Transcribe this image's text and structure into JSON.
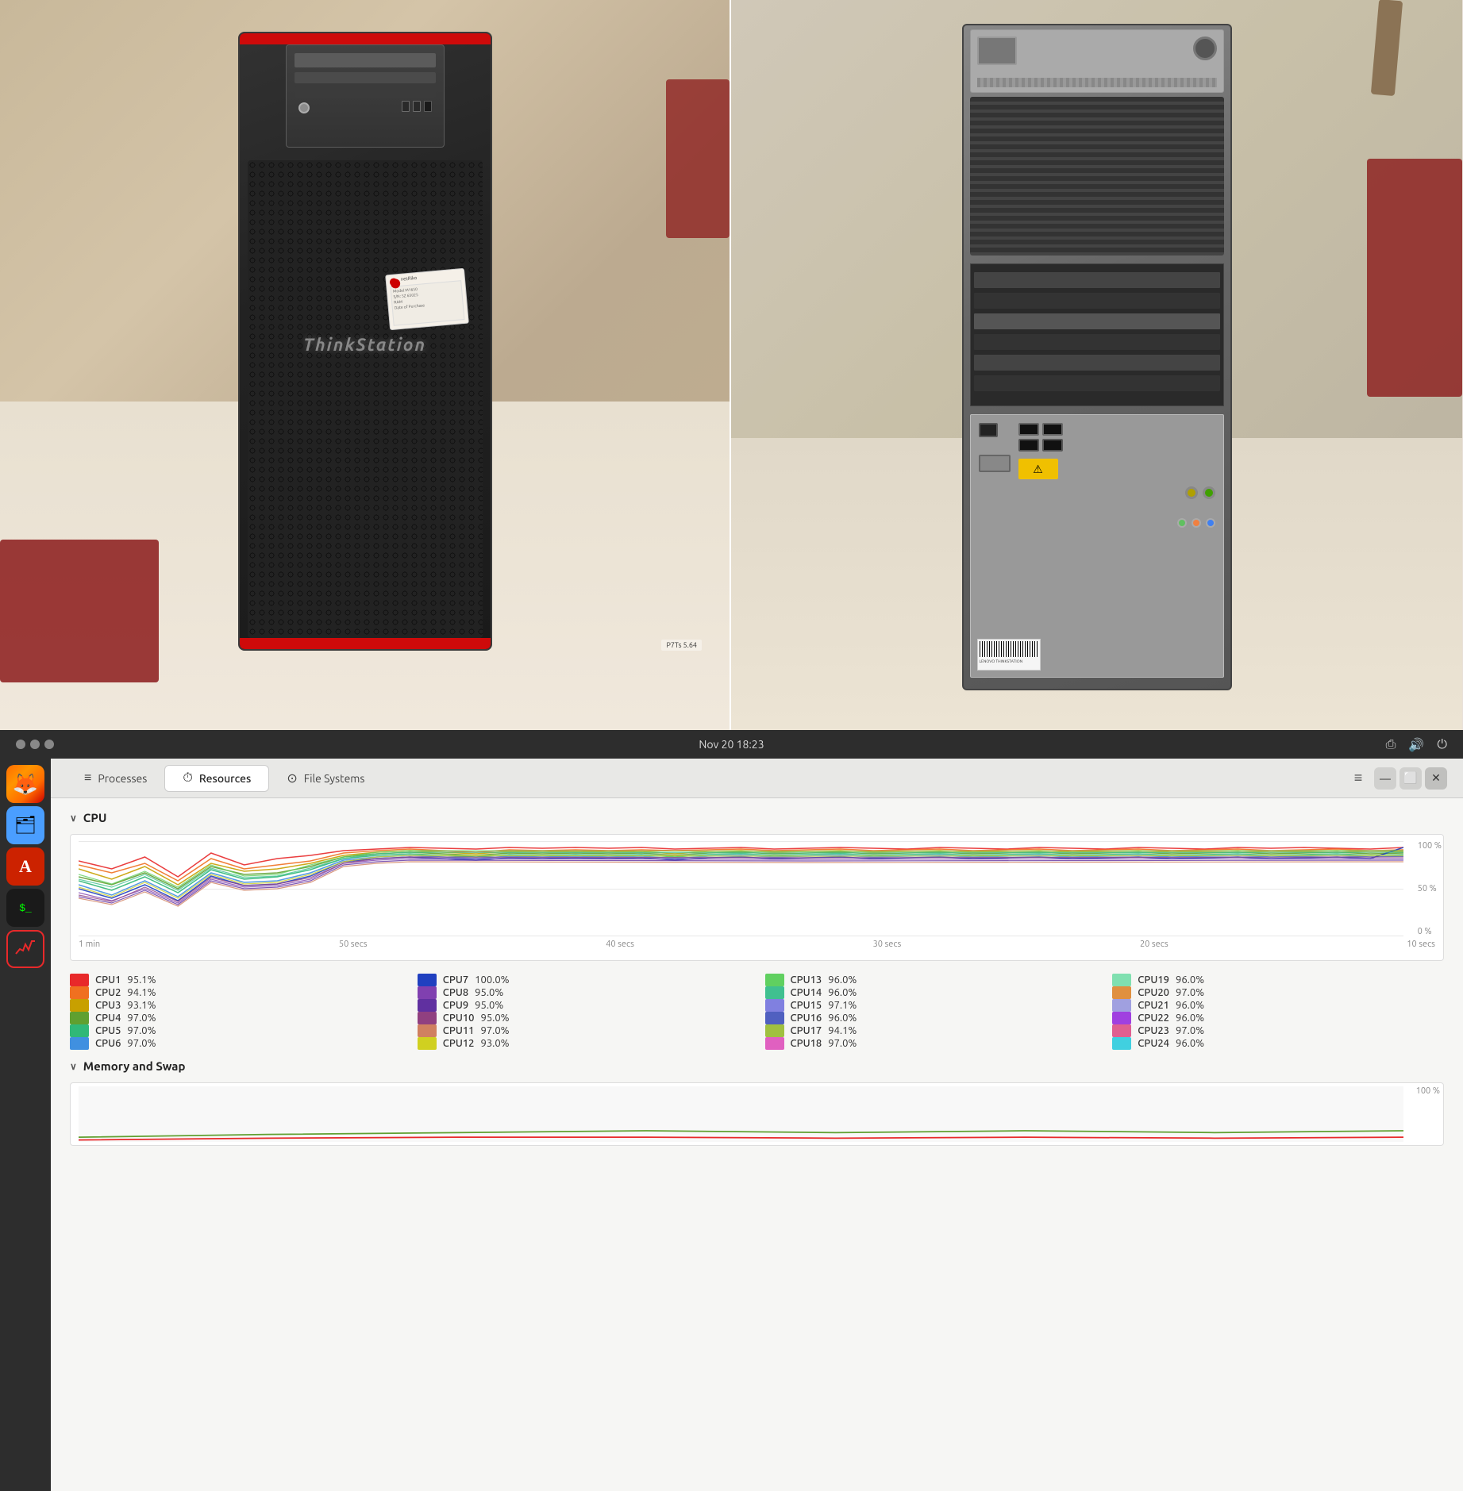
{
  "photos": {
    "left_alt": "ThinkStation front view",
    "right_alt": "ThinkStation back panel"
  },
  "titlebar": {
    "datetime": "Nov 20  18:23",
    "dots": [
      "dot1",
      "dot2",
      "dot3"
    ]
  },
  "tabs": {
    "processes": {
      "label": "Processes",
      "icon": "≡"
    },
    "resources": {
      "label": "Resources",
      "icon": "⏱",
      "active": true
    },
    "filesystems": {
      "label": "File Systems",
      "icon": "⊙"
    }
  },
  "window_buttons": {
    "menu": "≡",
    "minimize": "—",
    "maximize": "⬜",
    "close": "✕"
  },
  "cpu_section": {
    "title": "CPU",
    "chart_labels_x": [
      "1 min",
      "50 secs",
      "40 secs",
      "30 secs",
      "20 secs",
      "10 secs"
    ],
    "chart_labels_y": [
      "100 %",
      "50 %",
      "0 %"
    ],
    "cpu_list": [
      {
        "id": "CPU1",
        "color": "#e8292a",
        "value": "95.1%"
      },
      {
        "id": "CPU2",
        "color": "#f07020",
        "value": "94.1%"
      },
      {
        "id": "CPU3",
        "color": "#c8a000",
        "value": "93.1%"
      },
      {
        "id": "CPU4",
        "color": "#60a030",
        "value": "97.0%"
      },
      {
        "id": "CPU5",
        "color": "#30b878",
        "value": "97.0%"
      },
      {
        "id": "CPU6",
        "color": "#4090e0",
        "value": "97.0%"
      },
      {
        "id": "CPU7",
        "color": "#2040c0",
        "value": "100.0%"
      },
      {
        "id": "CPU8",
        "color": "#8040b0",
        "value": "95.0%"
      },
      {
        "id": "CPU9",
        "color": "#6030a0",
        "value": "95.0%"
      },
      {
        "id": "CPU10",
        "color": "#904080",
        "value": "95.0%"
      },
      {
        "id": "CPU11",
        "color": "#d08060",
        "value": "97.0%"
      },
      {
        "id": "CPU12",
        "color": "#d0d020",
        "value": "93.0%"
      },
      {
        "id": "CPU13",
        "color": "#60d060",
        "value": "96.0%"
      },
      {
        "id": "CPU14",
        "color": "#40c090",
        "value": "96.0%"
      },
      {
        "id": "CPU15",
        "color": "#8080e0",
        "value": "97.1%"
      },
      {
        "id": "CPU16",
        "color": "#5060c0",
        "value": "96.0%"
      },
      {
        "id": "CPU17",
        "color": "#a0c040",
        "value": "94.1%"
      },
      {
        "id": "CPU18",
        "color": "#e060c0",
        "value": "97.0%"
      },
      {
        "id": "CPU19",
        "color": "#80e0b0",
        "value": "96.0%"
      },
      {
        "id": "CPU20",
        "color": "#e09040",
        "value": "97.0%"
      },
      {
        "id": "CPU21",
        "color": "#a0a0e0",
        "value": "96.0%"
      },
      {
        "id": "CPU22",
        "color": "#a040e0",
        "value": "96.0%"
      },
      {
        "id": "CPU23",
        "color": "#e06090",
        "value": "97.0%"
      },
      {
        "id": "CPU24",
        "color": "#40d0e0",
        "value": "96.0%"
      }
    ]
  },
  "memory_section": {
    "title": "Memory and Swap",
    "chart_labels_y": [
      "100 %"
    ]
  },
  "sidebar": {
    "icons": [
      {
        "name": "firefox",
        "symbol": "🦊"
      },
      {
        "name": "files",
        "symbol": "🗂"
      },
      {
        "name": "appstore",
        "symbol": "A"
      },
      {
        "name": "terminal",
        "symbol": ">_"
      },
      {
        "name": "monitor",
        "symbol": "📊"
      }
    ]
  }
}
